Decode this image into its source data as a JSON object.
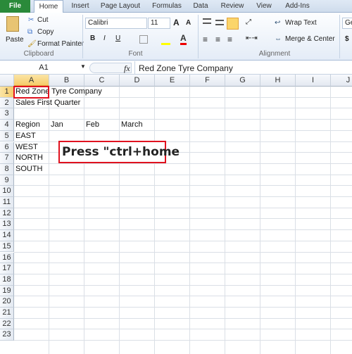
{
  "tabs": [
    "File",
    "Home",
    "Insert",
    "Page Layout",
    "Formulas",
    "Data",
    "Review",
    "View",
    "Add-Ins"
  ],
  "clipboard": {
    "paste": "Paste",
    "cut": "Cut",
    "copy": "Copy",
    "format_painter": "Format Painter",
    "label": "Clipboard"
  },
  "font": {
    "name": "Calibri",
    "size": "11",
    "bold": "B",
    "italic": "I",
    "underline": "U",
    "label": "Font"
  },
  "alignment": {
    "wrap_text": "Wrap Text",
    "merge_center": "Merge & Center",
    "label": "Alignment"
  },
  "number": {
    "format_partial": "Ge",
    "currency": "$"
  },
  "formula_bar": {
    "name_box": "A1",
    "fx": "fx",
    "value": "Red Zone Tyre Company"
  },
  "columns": [
    "A",
    "B",
    "C",
    "D",
    "E",
    "F",
    "G",
    "H",
    "I",
    "J"
  ],
  "rows": [
    "1",
    "2",
    "3",
    "4",
    "5",
    "6",
    "7",
    "8",
    "9",
    "10",
    "11",
    "12",
    "13",
    "14",
    "15",
    "16",
    "17",
    "18",
    "19",
    "20",
    "21",
    "22",
    "23"
  ],
  "cells": {
    "A1": "Red Zone Tyre Company",
    "A2": "Sales First Quarter",
    "A4": "Region",
    "B4": "Jan",
    "C4": "Feb",
    "D4": "March",
    "A5": "EAST",
    "A6": "WEST",
    "A7": "NORTH",
    "A8": "SOUTH"
  },
  "callout": "Press \"ctrl+home",
  "colors": {
    "highlight": "#e0121f",
    "file_tab": "#2a8a3a",
    "selected_header": "#f6cc6a"
  }
}
